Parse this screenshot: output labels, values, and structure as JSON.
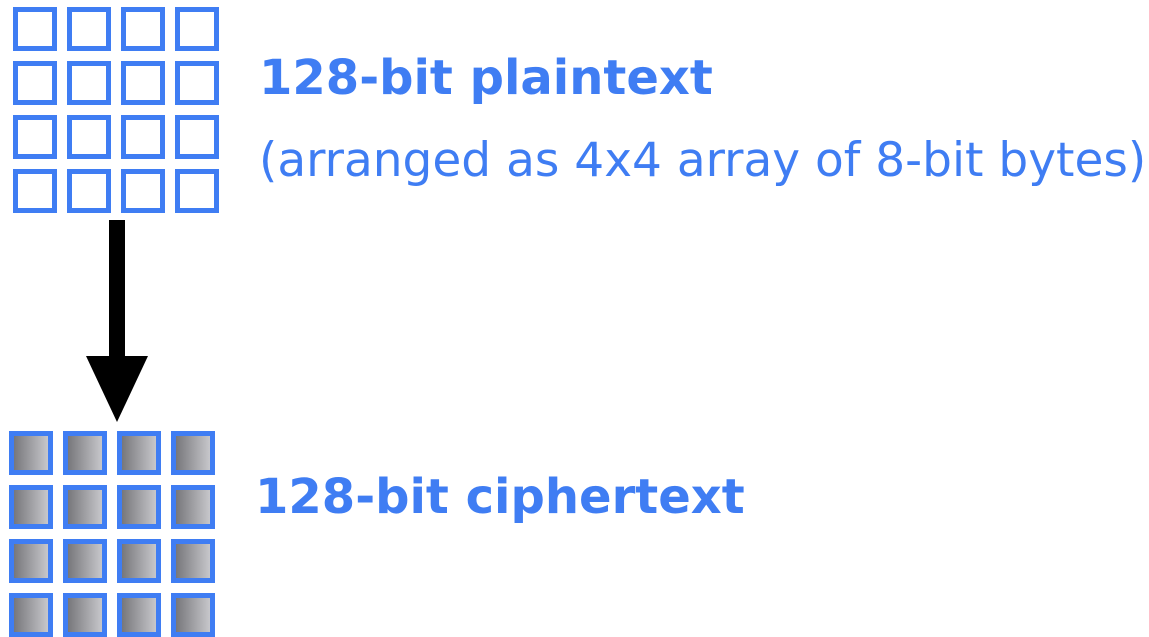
{
  "plaintext": {
    "title": "128-bit plaintext",
    "subtitle": "(arranged as 4x4 array of 8-bit bytes)",
    "grid": {
      "rows": 4,
      "cols": 4
    }
  },
  "ciphertext": {
    "title": "128-bit ciphertext",
    "grid": {
      "rows": 4,
      "cols": 4
    }
  },
  "colors": {
    "accent": "#3f7df3",
    "arrow": "#000000",
    "cipher_fill_dark": "#77777b",
    "cipher_fill_light": "#c7c7cb"
  },
  "icons": {
    "arrow": "arrow-down-icon"
  }
}
